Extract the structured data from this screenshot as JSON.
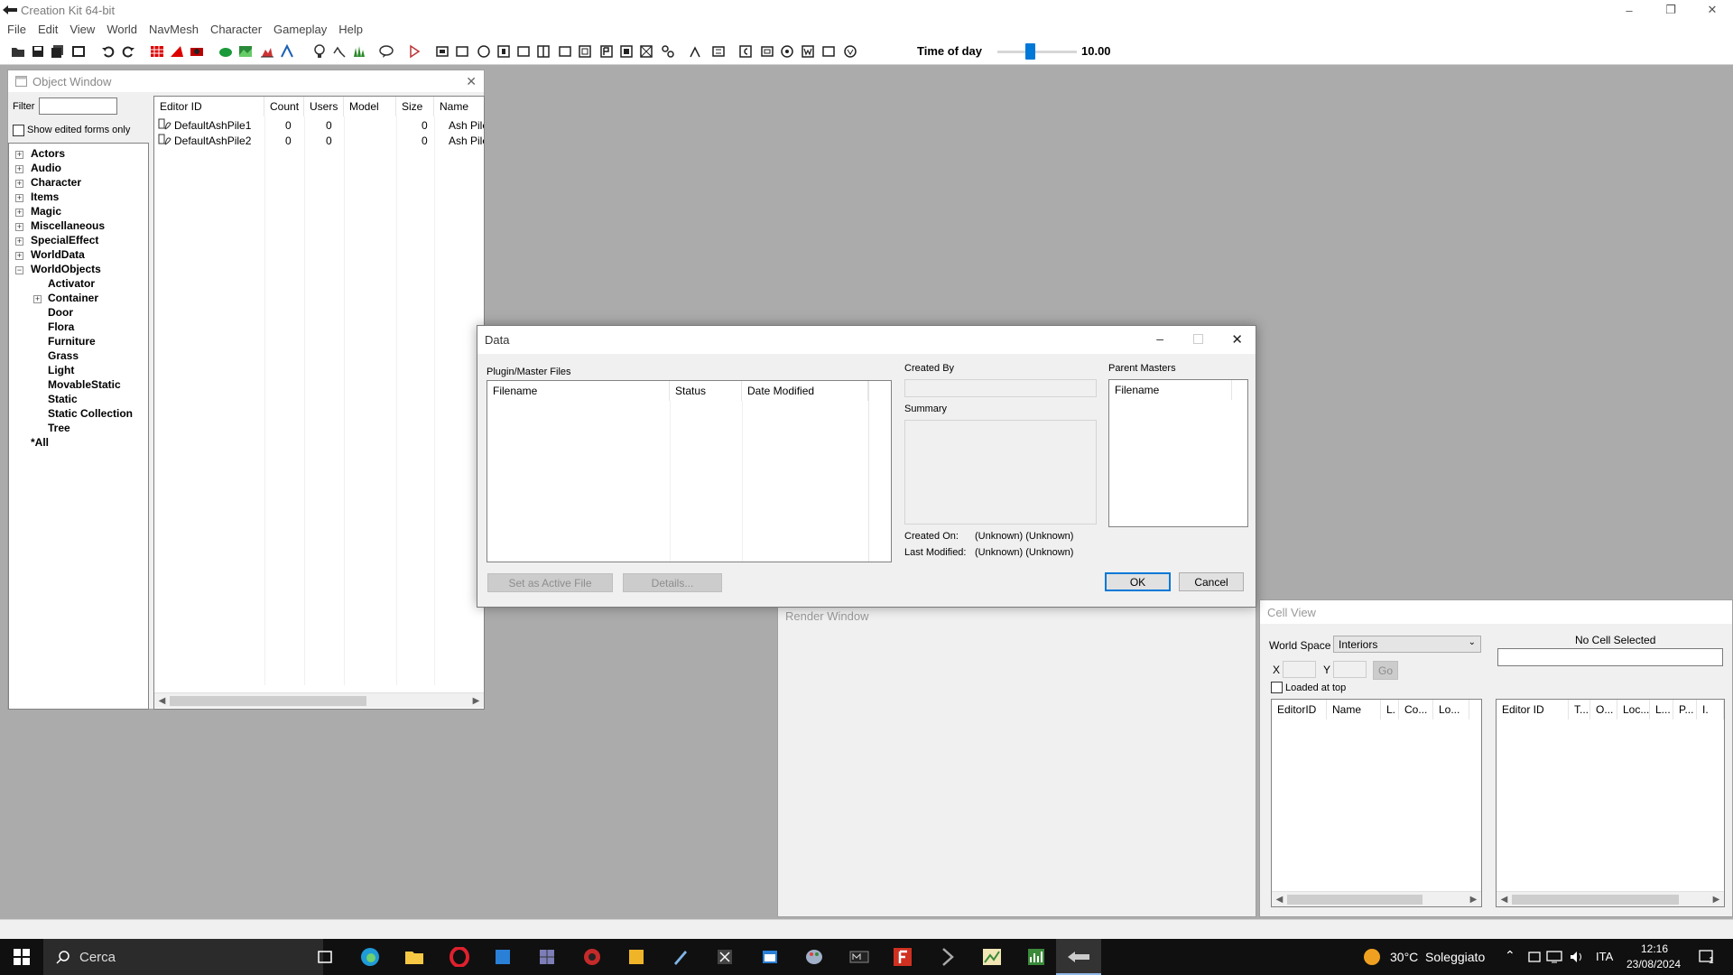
{
  "app": {
    "title": "Creation Kit 64-bit",
    "min_symbol": "–",
    "max_symbol": "❐",
    "close_symbol": "✕"
  },
  "menu": [
    "File",
    "Edit",
    "View",
    "World",
    "NavMesh",
    "Character",
    "Gameplay",
    "Help"
  ],
  "toolbar": {
    "time_of_day_label": "Time of day",
    "time_of_day_value": "10.00"
  },
  "object_window": {
    "title": "Object Window",
    "filter_label": "Filter",
    "filter_value": "",
    "show_edited_label": "Show edited forms only",
    "tree": [
      "Actors",
      "Audio",
      "Character",
      "Items",
      "Magic",
      "Miscellaneous",
      "SpecialEffect",
      "WorldData",
      "WorldObjects"
    ],
    "tree_children": [
      "Activator",
      "Container",
      "Door",
      "Flora",
      "Furniture",
      "Grass",
      "Light",
      "MovableStatic",
      "Static",
      "Static Collection",
      "Tree"
    ],
    "tree_all": "*All",
    "columns": [
      "Editor ID",
      "Count",
      "Users",
      "Model",
      "Size",
      "Name"
    ],
    "rows": [
      {
        "editor_id": "DefaultAshPile1",
        "count": "0",
        "users": "0",
        "model": "",
        "size": "0",
        "name": "Ash Pile"
      },
      {
        "editor_id": "DefaultAshPile2",
        "count": "0",
        "users": "0",
        "model": "",
        "size": "0",
        "name": "Ash Pile"
      }
    ]
  },
  "data_dialog": {
    "title": "Data",
    "plugin_label": "Plugin/Master Files",
    "columns": [
      "Filename",
      "Status",
      "Date Modified"
    ],
    "created_by_label": "Created By",
    "summary_label": "Summary",
    "parent_masters_label": "Parent Masters",
    "parent_columns": [
      "Filename"
    ],
    "created_on_label": "Created On:",
    "created_on_value": "(Unknown) (Unknown)",
    "last_modified_label": "Last Modified:",
    "last_modified_value": "(Unknown) (Unknown)",
    "set_active_label": "Set as Active File",
    "details_label": "Details...",
    "ok_label": "OK",
    "cancel_label": "Cancel"
  },
  "render_window": {
    "title": "Render Window"
  },
  "cell_view": {
    "title": "Cell View",
    "world_space_label": "World Space",
    "world_space_value": "Interiors",
    "no_cell_label": "No Cell Selected",
    "x_label": "X",
    "y_label": "Y",
    "go_label": "Go",
    "loaded_at_top_label": "Loaded at top",
    "left_columns": [
      "EditorID",
      "Name",
      "L.",
      "Co...",
      "Lo..."
    ],
    "right_columns": [
      "Editor ID",
      "T...",
      "O...",
      "Loc...",
      "L...",
      "P...",
      "I."
    ]
  },
  "taskbar": {
    "search_placeholder": "Cerca",
    "weather": "30°C  Soleggiato",
    "language": "ITA",
    "time": "12:16",
    "date": "23/08/2024",
    "notification_count": "1"
  },
  "colors": {
    "accent": "#0078d7",
    "taskbar": "#101010",
    "workspace": "#ababab"
  }
}
